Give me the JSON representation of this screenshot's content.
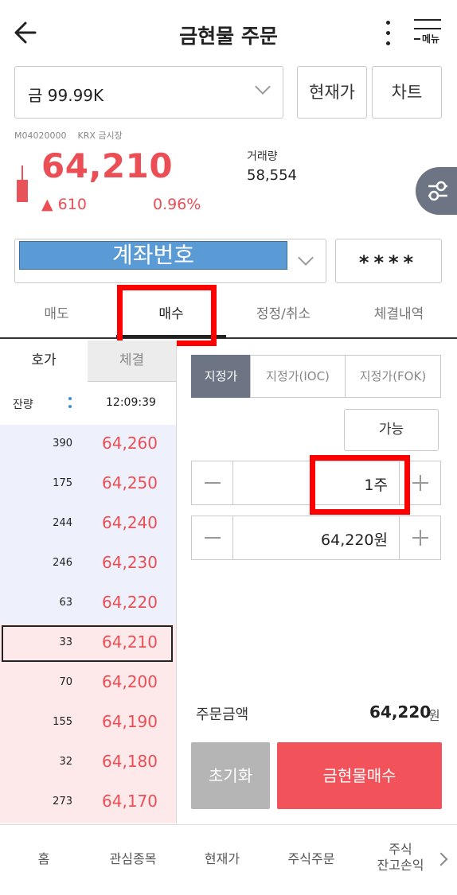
{
  "header": {
    "title": "금현물 주문",
    "menu_label": "메뉴"
  },
  "stock": {
    "name": "금 99.99K",
    "code": "M04020000",
    "market": "KRX 금시장",
    "price": "64,210",
    "change": "▲ 610",
    "change_pct": "0.96%",
    "volume_label": "거래량",
    "volume": "58,554"
  },
  "buttons": {
    "current_price": "현재가",
    "chart": "차트"
  },
  "account": {
    "number_label": "계좌번호",
    "password": "****"
  },
  "tabs": [
    "매도",
    "매수",
    "정정/취소",
    "체결내역"
  ],
  "active_tab": "매수",
  "orderbook": {
    "tabs": [
      "호가",
      "체결"
    ],
    "balance_label": "잔량",
    "time": "12:09:39",
    "asks": [
      {
        "qty": "390",
        "price": "64,260"
      },
      {
        "qty": "175",
        "price": "64,250"
      },
      {
        "qty": "244",
        "price": "64,240"
      },
      {
        "qty": "246",
        "price": "64,230"
      },
      {
        "qty": "63",
        "price": "64,220"
      }
    ],
    "bids": [
      {
        "qty": "33",
        "price": "64,210"
      },
      {
        "qty": "70",
        "price": "64,200"
      },
      {
        "qty": "155",
        "price": "64,190"
      },
      {
        "qty": "32",
        "price": "64,180"
      },
      {
        "qty": "273",
        "price": "64,170"
      }
    ]
  },
  "order": {
    "types": [
      "지정가",
      "지정가(IOC)",
      "지정가(FOK)"
    ],
    "selected_type": "지정가",
    "available_button": "가능",
    "quantity": "1주",
    "price": "64,220원",
    "amount_label": "주문금액",
    "amount": "64,220",
    "amount_unit": "원",
    "reset_button": "초기화",
    "buy_button": "금현물매수"
  },
  "bottom_nav": {
    "items": [
      "홈",
      "관심종목",
      "현재가",
      "주식주문"
    ],
    "last_line1": "주식",
    "last_line2": "잔고손익"
  },
  "colors": {
    "up_red": "#ec4e55",
    "buy_button": "#f2535a",
    "ask_bg": "#eef1fb",
    "bid_bg": "#fde9ea",
    "selected_type_bg": "#6d7585",
    "highlight": "#ff0000"
  }
}
